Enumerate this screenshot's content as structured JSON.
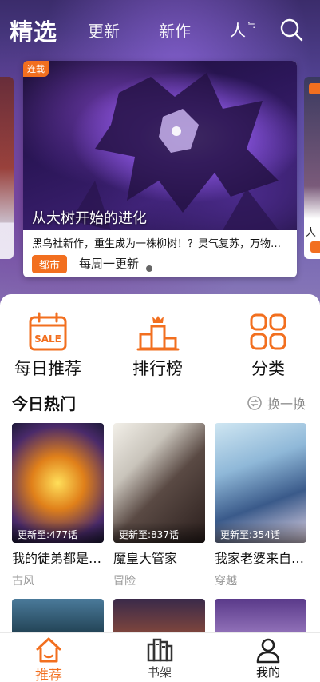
{
  "nav": {
    "tabs": [
      "精选",
      "更新",
      "新作"
    ],
    "gender_main": "人",
    "gender_sub": "≒",
    "search_icon": "search-icon"
  },
  "banner": {
    "status": "连载",
    "title": "从大树开始的进化",
    "description": "黑鸟社新作，重生成为一株柳树！？灵气复苏，万物进化，",
    "genre": "都市",
    "update_freq": "每周一更新"
  },
  "side_card_right": {
    "letter": "人"
  },
  "quick_links": [
    {
      "label": "每日推荐",
      "icon": "calendar-sale-icon",
      "badge": "SALE"
    },
    {
      "label": "排行榜",
      "icon": "ranking-podium-icon"
    },
    {
      "label": "分类",
      "icon": "category-grid-icon"
    }
  ],
  "hot_section": {
    "title": "今日热门",
    "refresh": "换一换"
  },
  "comics": [
    {
      "name": "我的徒弟都是大反派",
      "update": "更新至:477话",
      "genre": "古风"
    },
    {
      "name": "魔皇大管家",
      "update": "更新至:837话",
      "genre": "冒险"
    },
    {
      "name": "我家老婆来自一千年前",
      "update": "更新至:354话",
      "genre": "穿越"
    }
  ],
  "bottom_tabs": [
    {
      "label": "推荐",
      "icon": "home-icon",
      "active": true
    },
    {
      "label": "书架",
      "icon": "bookshelf-icon",
      "active": false
    },
    {
      "label": "我的",
      "icon": "profile-icon",
      "active": false
    }
  ],
  "colors": {
    "accent": "#f26f1f"
  }
}
